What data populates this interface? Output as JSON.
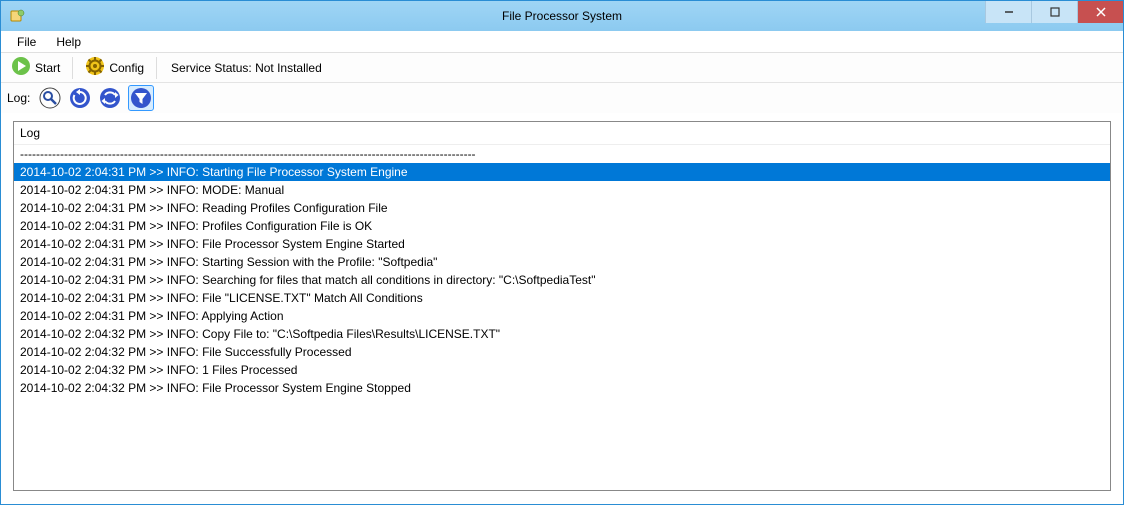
{
  "window": {
    "title": "File Processor System"
  },
  "menubar": {
    "file": "File",
    "help": "Help"
  },
  "toolbar": {
    "start_label": "Start",
    "config_label": "Config",
    "service_status": "Service Status: Not Installed"
  },
  "logbar": {
    "label": "Log:"
  },
  "log": {
    "header": "Log",
    "separator": "------------------------------------------------------------------------------------------------------------------",
    "entries": [
      "2014-10-02 2:04:31 PM >> INFO: Starting File Processor System Engine",
      "2014-10-02 2:04:31 PM >> INFO: MODE: Manual",
      "2014-10-02 2:04:31 PM >> INFO: Reading Profiles Configuration File",
      "2014-10-02 2:04:31 PM >> INFO: Profiles Configuration File is OK",
      "2014-10-02 2:04:31 PM >> INFO: File Processor System Engine Started",
      "2014-10-02 2:04:31 PM >> INFO: Starting Session with the Profile: \"Softpedia\"",
      "2014-10-02 2:04:31 PM >> INFO: Searching for files that match all conditions in directory: \"C:\\SoftpediaTest\"",
      "2014-10-02 2:04:31 PM >> INFO: File \"LICENSE.TXT\" Match All Conditions",
      "2014-10-02 2:04:31 PM >> INFO: Applying Action",
      "2014-10-02 2:04:32 PM >> INFO: Copy File to: \"C:\\Softpedia Files\\Results\\LICENSE.TXT\"",
      "2014-10-02 2:04:32 PM >> INFO: File Successfully Processed",
      "2014-10-02 2:04:32 PM >> INFO: 1 Files Processed",
      "2014-10-02 2:04:32 PM >> INFO: File Processor System Engine Stopped"
    ],
    "selected_index": 0
  }
}
